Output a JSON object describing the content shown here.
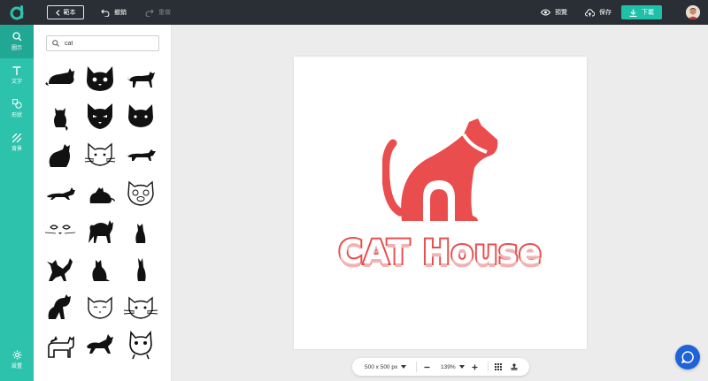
{
  "topbar": {
    "back_label": "範本",
    "undo_label": "撤銷",
    "redo_label": "重做",
    "preview_label": "預覽",
    "save_label": "保存",
    "download_label": "下載"
  },
  "rail": {
    "items": [
      {
        "label": "圖示",
        "icon": "search-icon",
        "active": true
      },
      {
        "label": "文字",
        "icon": "text-icon",
        "active": false
      },
      {
        "label": "形狀",
        "icon": "shapes-icon",
        "active": false
      },
      {
        "label": "背景",
        "icon": "background-icon",
        "active": false
      }
    ],
    "settings_label": "設置"
  },
  "panel": {
    "search_value": "cat",
    "icons": [
      "cat-lying-icon",
      "cat-face-outline-icon",
      "cat-walking-icon",
      "cat-sitting-back-icon",
      "cat-mask-icon",
      "cat-head-icon",
      "cat-sitting-icon",
      "cat-face-whiskers-icon",
      "cat-running-icon",
      "cat-stretch-icon",
      "cat-crouch-icon",
      "cat-cartoon-face-icon",
      "cat-eyes-icon",
      "cat-arched-icon",
      "cat-sitting-slim-icon",
      "cat-playing-icon",
      "cat-sitting-2-icon",
      "cat-sitting-3-icon",
      "cat-licking-icon",
      "cat-face-simple-icon",
      "cat-face-whiskers-2-icon",
      "cat-standing-icon",
      "cat-walking-2-icon",
      "cat-cartoon-icon"
    ]
  },
  "canvas": {
    "headline": "CAT House",
    "brand_color": "#ea4d4d"
  },
  "bottom_bar": {
    "size_label": "500 x 500 px",
    "zoom_label": "139%"
  },
  "colors": {
    "topbar": "#2a2f35",
    "accent": "#2cc2ac",
    "chat": "#1f63d9"
  }
}
